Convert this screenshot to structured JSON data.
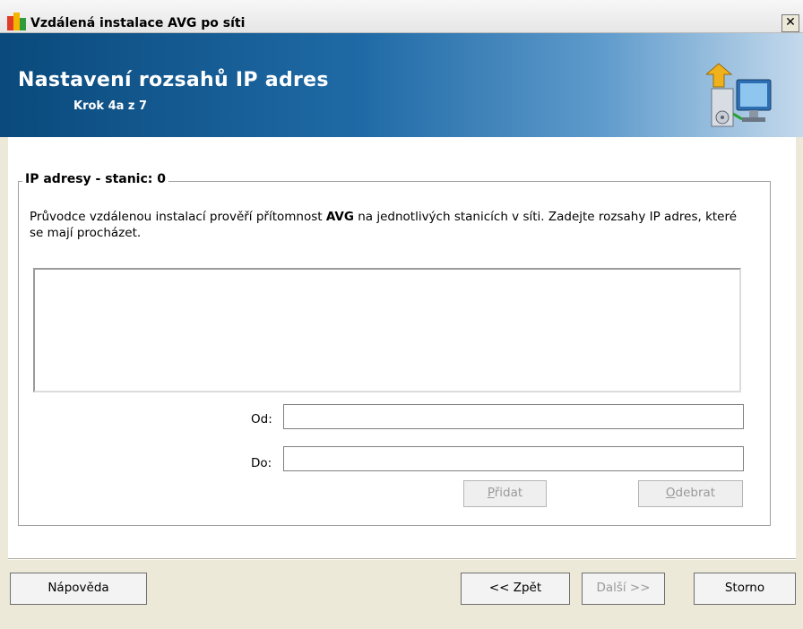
{
  "window": {
    "title": "Vzdálená instalace AVG po síti",
    "close_glyph": "✕"
  },
  "banner": {
    "title": "Nastavení rozsahů IP adres",
    "step": "Krok 4a z 7",
    "icon": "computer-install-icon"
  },
  "group": {
    "legend": "IP adresy - stanic: 0",
    "description_before": "Průvodce vzdálenou instalací prověří přítomnost ",
    "description_bold": "AVG",
    "description_after": " na jednotlivých stanicích v síti. Zadejte rozsahy IP adres, které se mají procházet."
  },
  "range": {
    "from_label": "Od:",
    "from_value": "",
    "to_label": "Do:",
    "to_value": "",
    "add_button": {
      "accel": "P",
      "rest": "řidat"
    },
    "remove_button": {
      "accel": "O",
      "rest": "debrat"
    }
  },
  "footer": {
    "help": "Nápověda",
    "back": "<< Zpět",
    "next": "Další >>",
    "cancel": "Storno"
  },
  "colors": {
    "banner_dark": "#0a4a7c",
    "banner_light": "#c4d9ec",
    "face": "#ece9d8"
  }
}
